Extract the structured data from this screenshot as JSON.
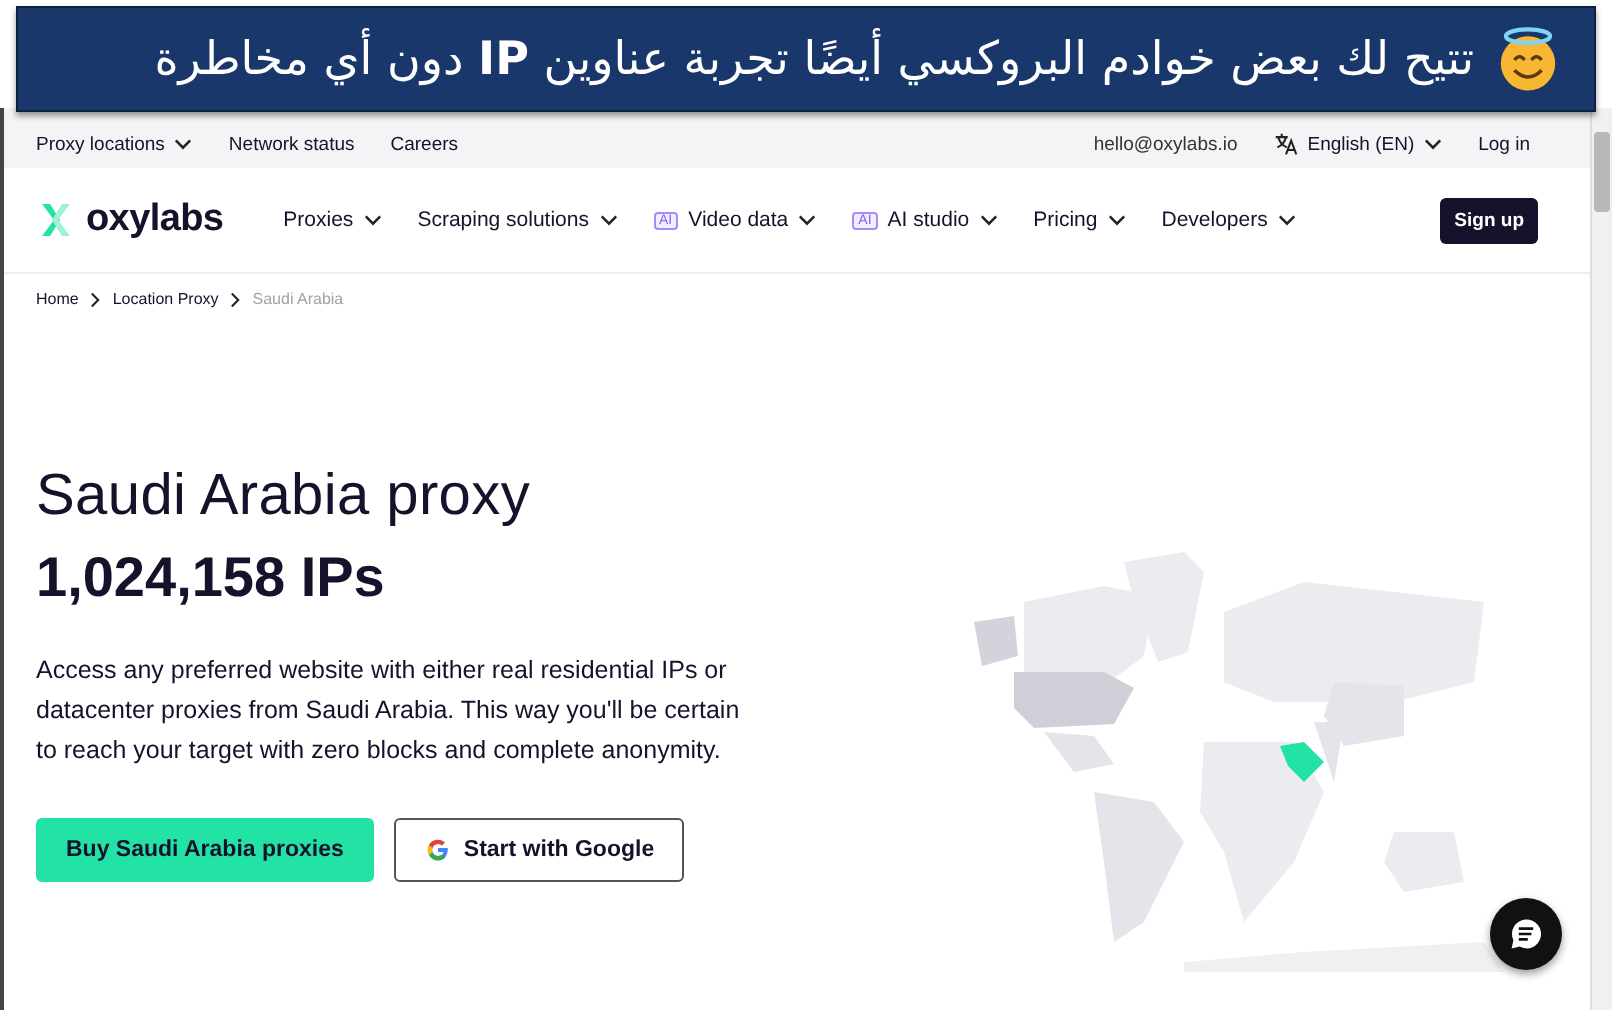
{
  "banner": {
    "text": "تتيح لك بعض خوادم البروكسي أيضًا تجربة عناوين **IP** دون أي مخاطرة"
  },
  "top_bar": {
    "links": [
      {
        "label": "Proxy locations",
        "dropdown": true
      },
      {
        "label": "Network status",
        "dropdown": false
      },
      {
        "label": "Careers",
        "dropdown": false
      }
    ],
    "email": "hello@oxylabs.io",
    "language": {
      "label": "English (EN)",
      "dropdown": true
    },
    "login": "Log in"
  },
  "nav": {
    "logo": "oxylabs",
    "items": [
      {
        "label": "Proxies"
      },
      {
        "label": "Scraping solutions"
      },
      {
        "label": "Video data",
        "badge": "AI"
      },
      {
        "label": "AI studio",
        "badge": "AI"
      },
      {
        "label": "Pricing"
      },
      {
        "label": "Developers"
      }
    ],
    "sign_up": "Sign up"
  },
  "breadcrumb": [
    {
      "label": "Home",
      "current": false
    },
    {
      "label": "Location Proxy",
      "current": false
    },
    {
      "label": "Saudi Arabia",
      "current": true
    }
  ],
  "hero": {
    "title": "Saudi Arabia proxy",
    "subtitle": "1,024,158 IPs",
    "description": "Access any preferred website with either real residential IPs or datacenter proxies from Saudi Arabia. This way you'll be certain to reach your target with zero blocks and complete anonymity.",
    "buttons": [
      {
        "label": "Buy Saudi Arabia proxies",
        "kind": "primary"
      },
      {
        "label": "Start with Google",
        "kind": "google"
      }
    ]
  }
}
